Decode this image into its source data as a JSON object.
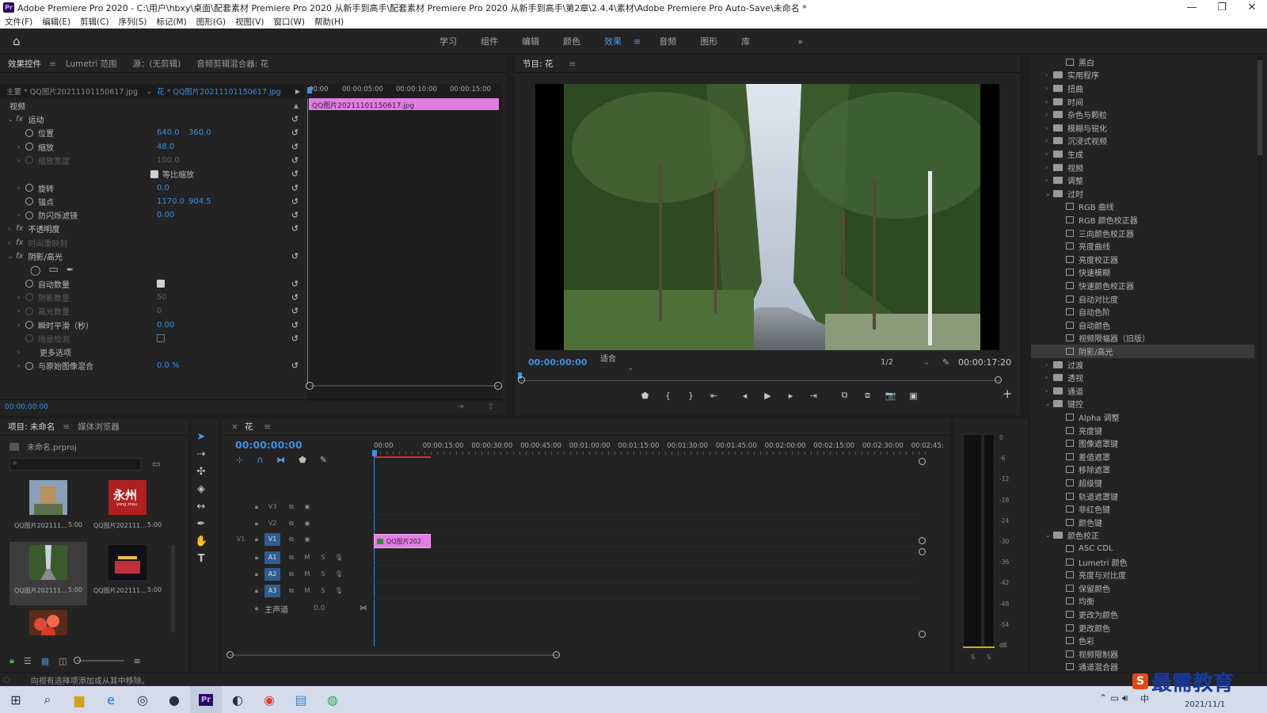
{
  "window": {
    "app_badge": "Pr",
    "title": "Adobe Premiere Pro 2020 - C:\\用户\\hbxy\\桌面\\配套素材 Premiere Pro 2020 从新手到高手\\配套素材 Premiere Pro 2020 从新手到高手\\第2章\\2.4.4\\素材\\Adobe Premiere Pro Auto-Save\\未命名 *",
    "controls": [
      "—",
      "❐",
      "✕"
    ]
  },
  "menu": [
    "文件(F)",
    "编辑(E)",
    "剪辑(C)",
    "序列(S)",
    "标记(M)",
    "图形(G)",
    "视图(V)",
    "窗口(W)",
    "帮助(H)"
  ],
  "workspaces": {
    "tabs": [
      "学习",
      "组件",
      "编辑",
      "颜色",
      "效果",
      "音频",
      "图形",
      "库"
    ],
    "active": "效果",
    "more": "»"
  },
  "effect_controls": {
    "tabs": [
      "效果控件",
      "Lumetri 范围",
      "源：(无剪辑)",
      "音频剪辑混合器: 花"
    ],
    "master_label": "主要 * QQ图片20211101150617.jpg",
    "clip_label": "花 * QQ图片20211101150617.jpg",
    "ruler": [
      "00:00",
      "00:00:05:00",
      "00:00:10:00",
      "00:00:15:00"
    ],
    "clip_bar": "QQ图片20211101150617.jpg",
    "section": "视频",
    "rows": [
      {
        "type": "group",
        "label": "运动",
        "fx": "fx"
      },
      {
        "type": "prop",
        "label": "位置",
        "v1": "640.0",
        "v2": "360.0"
      },
      {
        "type": "prop",
        "label": "缩放",
        "v1": "48.0",
        "exp": true
      },
      {
        "type": "prop-dim",
        "label": "缩放宽度",
        "v1": "100.0",
        "exp": true
      },
      {
        "type": "check",
        "label": "等比缩放"
      },
      {
        "type": "prop",
        "label": "旋转",
        "v1": "0.0",
        "exp": true
      },
      {
        "type": "prop",
        "label": "锚点",
        "v1": "1170.0",
        "v2": "904.5"
      },
      {
        "type": "prop",
        "label": "防闪烁滤镜",
        "v1": "0.00",
        "exp": true
      },
      {
        "type": "group",
        "label": "不透明度",
        "fx": "fx",
        "collapsed": true
      },
      {
        "type": "group-dim",
        "label": "时间重映射",
        "fx": "fx",
        "collapsed": true
      },
      {
        "type": "group",
        "label": "阴影/高光",
        "fx": "fx"
      },
      {
        "type": "shapes"
      },
      {
        "type": "prop-check",
        "label": "自动数量"
      },
      {
        "type": "prop-dim",
        "label": "阴影数量",
        "v1": "50",
        "exp": true
      },
      {
        "type": "prop-dim",
        "label": "高光数量",
        "v1": "0",
        "exp": true
      },
      {
        "type": "prop",
        "label": "瞬时平滑（秒）",
        "v1": "0.00",
        "exp": true
      },
      {
        "type": "prop-dim-check",
        "label": "场景检测"
      },
      {
        "type": "more",
        "label": "更多选项"
      },
      {
        "type": "prop",
        "label": "与原始图像混合",
        "v1": "0.0 %",
        "exp": true
      }
    ],
    "timecode": "00:00:00:00"
  },
  "program": {
    "tab": "节目: 花",
    "timecode": "00:00:00:00",
    "fit": "适合",
    "resolution": "1/2",
    "duration": "00:00:17:20",
    "transport": [
      "⬟",
      "{",
      "}",
      "⇤",
      "◂",
      "▶",
      "▸",
      "⇥",
      "⧉",
      "⧈",
      "📷",
      "▣"
    ],
    "add": "+"
  },
  "effects_tree": [
    {
      "kind": "fx",
      "level": 2,
      "label": "黑白"
    },
    {
      "kind": "folder",
      "level": 1,
      "label": "实用程序"
    },
    {
      "kind": "folder",
      "level": 1,
      "label": "扭曲"
    },
    {
      "kind": "folder",
      "level": 1,
      "label": "时间"
    },
    {
      "kind": "folder",
      "level": 1,
      "label": "杂色与颗粒"
    },
    {
      "kind": "folder",
      "level": 1,
      "label": "模糊与锐化"
    },
    {
      "kind": "folder",
      "level": 1,
      "label": "沉浸式视频"
    },
    {
      "kind": "folder",
      "level": 1,
      "label": "生成"
    },
    {
      "kind": "folder",
      "level": 1,
      "label": "视频"
    },
    {
      "kind": "folder",
      "level": 1,
      "label": "调整"
    },
    {
      "kind": "folder-open",
      "level": 1,
      "label": "过时"
    },
    {
      "kind": "fx",
      "level": 2,
      "label": "RGB 曲线"
    },
    {
      "kind": "fx",
      "level": 2,
      "label": "RGB 颜色校正器"
    },
    {
      "kind": "fx",
      "level": 2,
      "label": "三向颜色校正器"
    },
    {
      "kind": "fx",
      "level": 2,
      "label": "亮度曲线"
    },
    {
      "kind": "fx",
      "level": 2,
      "label": "亮度校正器"
    },
    {
      "kind": "fx",
      "level": 2,
      "label": "快速模糊"
    },
    {
      "kind": "fx",
      "level": 2,
      "label": "快速颜色校正器"
    },
    {
      "kind": "fx",
      "level": 2,
      "label": "自动对比度"
    },
    {
      "kind": "fx",
      "level": 2,
      "label": "自动色阶"
    },
    {
      "kind": "fx",
      "level": 2,
      "label": "自动颜色"
    },
    {
      "kind": "fx",
      "level": 2,
      "label": "视频限幅器（旧版）"
    },
    {
      "kind": "fx",
      "level": 2,
      "label": "阴影/高光",
      "selected": true
    },
    {
      "kind": "folder",
      "level": 1,
      "label": "过渡"
    },
    {
      "kind": "folder",
      "level": 1,
      "label": "透视"
    },
    {
      "kind": "folder",
      "level": 1,
      "label": "通道"
    },
    {
      "kind": "folder-open",
      "level": 1,
      "label": "键控"
    },
    {
      "kind": "fx",
      "level": 2,
      "label": "Alpha 调整"
    },
    {
      "kind": "fx",
      "level": 2,
      "label": "亮度键"
    },
    {
      "kind": "fx",
      "level": 2,
      "label": "图像遮罩键"
    },
    {
      "kind": "fx",
      "level": 2,
      "label": "差值遮罩"
    },
    {
      "kind": "fx",
      "level": 2,
      "label": "移除遮罩"
    },
    {
      "kind": "fx",
      "level": 2,
      "label": "超级键"
    },
    {
      "kind": "fx",
      "level": 2,
      "label": "轨道遮罩键"
    },
    {
      "kind": "fx",
      "level": 2,
      "label": "非红色键"
    },
    {
      "kind": "fx",
      "level": 2,
      "label": "颜色键"
    },
    {
      "kind": "folder-open",
      "level": 1,
      "label": "颜色校正"
    },
    {
      "kind": "fx",
      "level": 2,
      "label": "ASC CDL"
    },
    {
      "kind": "fx",
      "level": 2,
      "label": "Lumetri 颜色"
    },
    {
      "kind": "fx",
      "level": 2,
      "label": "亮度与对比度"
    },
    {
      "kind": "fx",
      "level": 2,
      "label": "保留颜色"
    },
    {
      "kind": "fx",
      "level": 2,
      "label": "均衡"
    },
    {
      "kind": "fx",
      "level": 2,
      "label": "更改为颜色"
    },
    {
      "kind": "fx",
      "level": 2,
      "label": "更改颜色"
    },
    {
      "kind": "fx",
      "level": 2,
      "label": "色彩"
    },
    {
      "kind": "fx",
      "level": 2,
      "label": "视频限制器"
    },
    {
      "kind": "fx",
      "level": 2,
      "label": "通道混合器"
    }
  ],
  "project": {
    "tabs": [
      "项目: 未命名",
      "媒体浏览器"
    ],
    "file": "未命名.prproj",
    "items": [
      {
        "name": "QQ图片202111...",
        "dur": "5:00",
        "thumb": "statue"
      },
      {
        "name": "QQ图片202111...",
        "dur": "5:00",
        "thumb": "sign",
        "sign_text": "永州",
        "sign_sub": "yong zhou"
      },
      {
        "name": "QQ图片202111...",
        "dur": "5:00",
        "thumb": "road",
        "selected": true
      },
      {
        "name": "QQ图片202111...",
        "dur": "5:00",
        "thumb": "night"
      },
      {
        "name": "",
        "dur": "",
        "thumb": "flower"
      }
    ]
  },
  "timeline": {
    "tab": "花",
    "timecode": "00:00:00:00",
    "ruler": [
      "00:00",
      "00:00:15:00",
      "00:00:30:00",
      "00:00:45:00",
      "00:01:00:00",
      "00:01:15:00",
      "00:01:30:00",
      "00:01:45:00",
      "00:02:00:00",
      "00:02:15:00",
      "00:02:30:00",
      "00:02:45:"
    ],
    "video_tracks": [
      "V3",
      "V2",
      "V1"
    ],
    "audio_tracks": [
      "A1",
      "A2",
      "A3"
    ],
    "source_v": "V1",
    "clip": "QQ图片202",
    "master": "主声道",
    "master_val": "0.0"
  },
  "meter": {
    "scale": [
      "0",
      "-6",
      "-12",
      "-18",
      "-24",
      "-30",
      "-36",
      "-42",
      "-48",
      "-54",
      "dB"
    ],
    "channels": [
      "S",
      "S"
    ]
  },
  "status": "向视有选择项添加或从其中移除。",
  "taskbar": {
    "time": "2021/11/1",
    "watermark": "最需教育",
    "ime": "中"
  }
}
